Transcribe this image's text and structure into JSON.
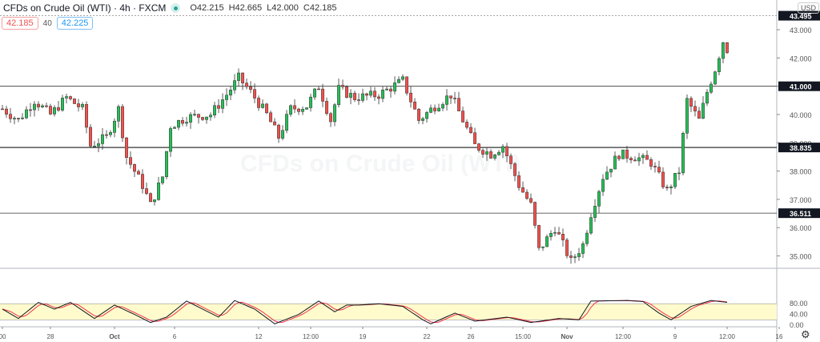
{
  "header": {
    "title": "CFDs on Crude Oil (WTI) · 4h · FXCM",
    "open": "O42.215",
    "high": "H42.665",
    "low": "L42.000",
    "close": "C42.185",
    "sell_price": "42.185",
    "spread": "40",
    "buy_price": "42.225",
    "currency": "USD",
    "watermark": "CFDs on Crude Oil (WTI)"
  },
  "colors": {
    "up": "#26a69a",
    "up_fill": "#2bbd5a",
    "down": "#ef5350",
    "stoch_k": "#131722",
    "stoch_d": "#f23645",
    "band": "#fffbcc"
  },
  "chart_data": {
    "type": "candlestick",
    "title": "CFDs on Crude Oil (WTI) · 4h · FXCM",
    "ylim": [
      34.6,
      43.8
    ],
    "y_ticks": [
      "43.000",
      "42.000",
      "41.000",
      "40.000",
      "39.000",
      "38.000",
      "37.000",
      "36.000",
      "35.000"
    ],
    "y_tick_values": [
      43,
      42,
      41,
      40,
      39,
      38,
      37,
      36,
      35
    ],
    "x_ticks": [
      "00",
      "28",
      "Oct",
      "6",
      "12",
      "12:00",
      "19",
      "22",
      "26",
      "15:00",
      "Nov",
      "12:00",
      "9",
      "12:00",
      "16"
    ],
    "x_tick_bars": [
      0,
      12,
      28,
      43,
      64,
      77,
      90,
      106,
      117,
      130,
      141,
      155,
      168,
      181,
      194
    ],
    "horizontal_lines": [
      {
        "value": "43.495",
        "style": "dotted"
      },
      {
        "value": "41.000",
        "style": "solid"
      },
      {
        "value": "38.835",
        "style": "solid"
      },
      {
        "value": "36.511",
        "style": "solid"
      }
    ],
    "last_price": "42.185",
    "close_path_bars": [
      0,
      4,
      8,
      12,
      16,
      20,
      22,
      26,
      29,
      31,
      35,
      37,
      40,
      42,
      46,
      52,
      56,
      59,
      62,
      66,
      69,
      72,
      76,
      79,
      82,
      84,
      88,
      94,
      100,
      104,
      108,
      112,
      115,
      118,
      122,
      125,
      129,
      132,
      134,
      138,
      142,
      145,
      147,
      150,
      154,
      158,
      162,
      166,
      169,
      171,
      174,
      176,
      178,
      180,
      181
    ],
    "close_path": [
      40.2,
      39.8,
      40.5,
      40.0,
      40.6,
      40.2,
      38.9,
      39.2,
      40.2,
      38.5,
      37.5,
      36.8,
      37.8,
      39.6,
      39.9,
      40.0,
      40.7,
      41.3,
      40.8,
      40.0,
      39.2,
      40.2,
      40.3,
      41.0,
      39.8,
      40.9,
      40.6,
      40.7,
      41.2,
      39.8,
      40.3,
      40.7,
      39.8,
      38.9,
      38.6,
      38.9,
      37.5,
      36.8,
      35.2,
      36.0,
      34.8,
      35.4,
      36.5,
      37.8,
      38.6,
      38.5,
      38.3,
      37.3,
      38.0,
      40.5,
      39.8,
      40.8,
      41.6,
      42.6,
      42.185
    ],
    "stochastic": {
      "ylim": [
        0,
        100
      ],
      "y_ticks": [
        "80.00",
        "40.00",
        "0.00"
      ],
      "y_tick_values": [
        80,
        40,
        0
      ],
      "band": [
        20,
        80
      ],
      "bars": [
        0,
        4,
        9,
        13,
        17,
        23,
        28,
        33,
        37,
        41,
        46,
        54,
        58,
        63,
        68,
        74,
        79,
        83,
        86,
        89,
        94,
        100,
        105,
        107,
        113,
        118,
        126,
        132,
        139,
        144,
        147,
        156,
        160,
        164,
        167,
        172,
        177,
        181
      ],
      "k": [
        60,
        25,
        85,
        60,
        85,
        25,
        75,
        40,
        10,
        30,
        90,
        30,
        92,
        60,
        5,
        40,
        90,
        50,
        75,
        75,
        80,
        70,
        20,
        5,
        45,
        15,
        30,
        10,
        25,
        20,
        90,
        92,
        88,
        45,
        20,
        70,
        92,
        85
      ]
    }
  },
  "axis": {
    "settings": "⚙"
  }
}
